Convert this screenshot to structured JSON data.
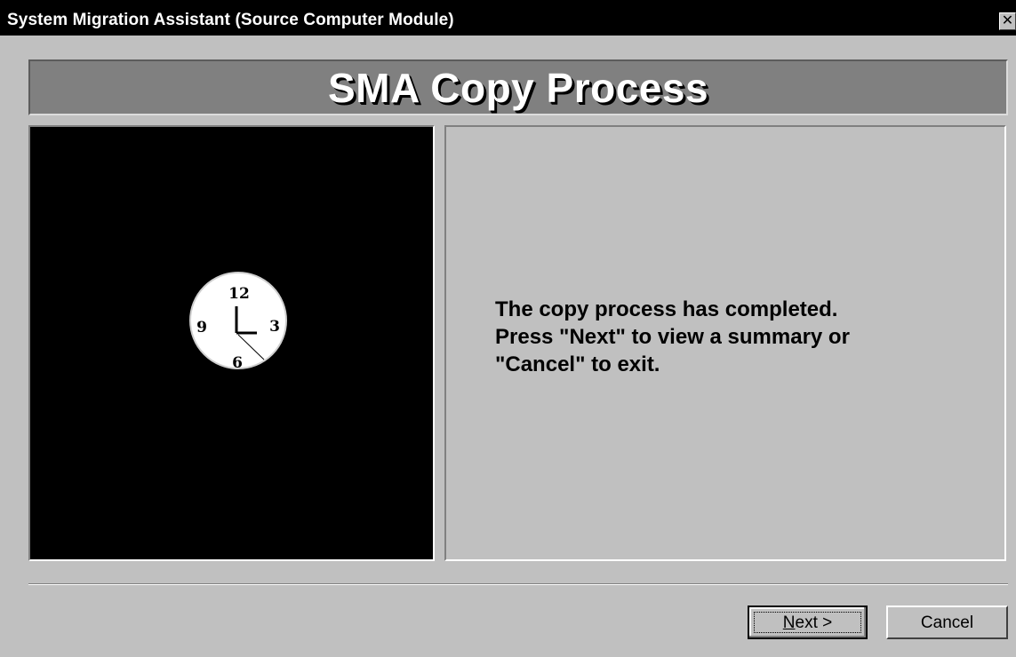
{
  "window": {
    "title": "System Migration Assistant (Source Computer Module)",
    "close_glyph": "✕"
  },
  "header": {
    "title": "SMA Copy Process"
  },
  "clock": {
    "numerals": {
      "n12": "12",
      "n3": "3",
      "n6": "6",
      "n9": "9"
    },
    "icon": "clock-icon"
  },
  "message": {
    "lines": [
      "The copy process has completed.",
      "Press \"Next\" to view a summary or",
      "\"Cancel\" to exit."
    ]
  },
  "buttons": {
    "next_prefix": "",
    "next_accel": "N",
    "next_rest": "ext >",
    "cancel": "Cancel"
  },
  "colors": {
    "titlebar": "#000000",
    "dialog_bg": "#c0c0c0",
    "header_bg": "#808080",
    "clock_panel_bg": "#000000"
  }
}
